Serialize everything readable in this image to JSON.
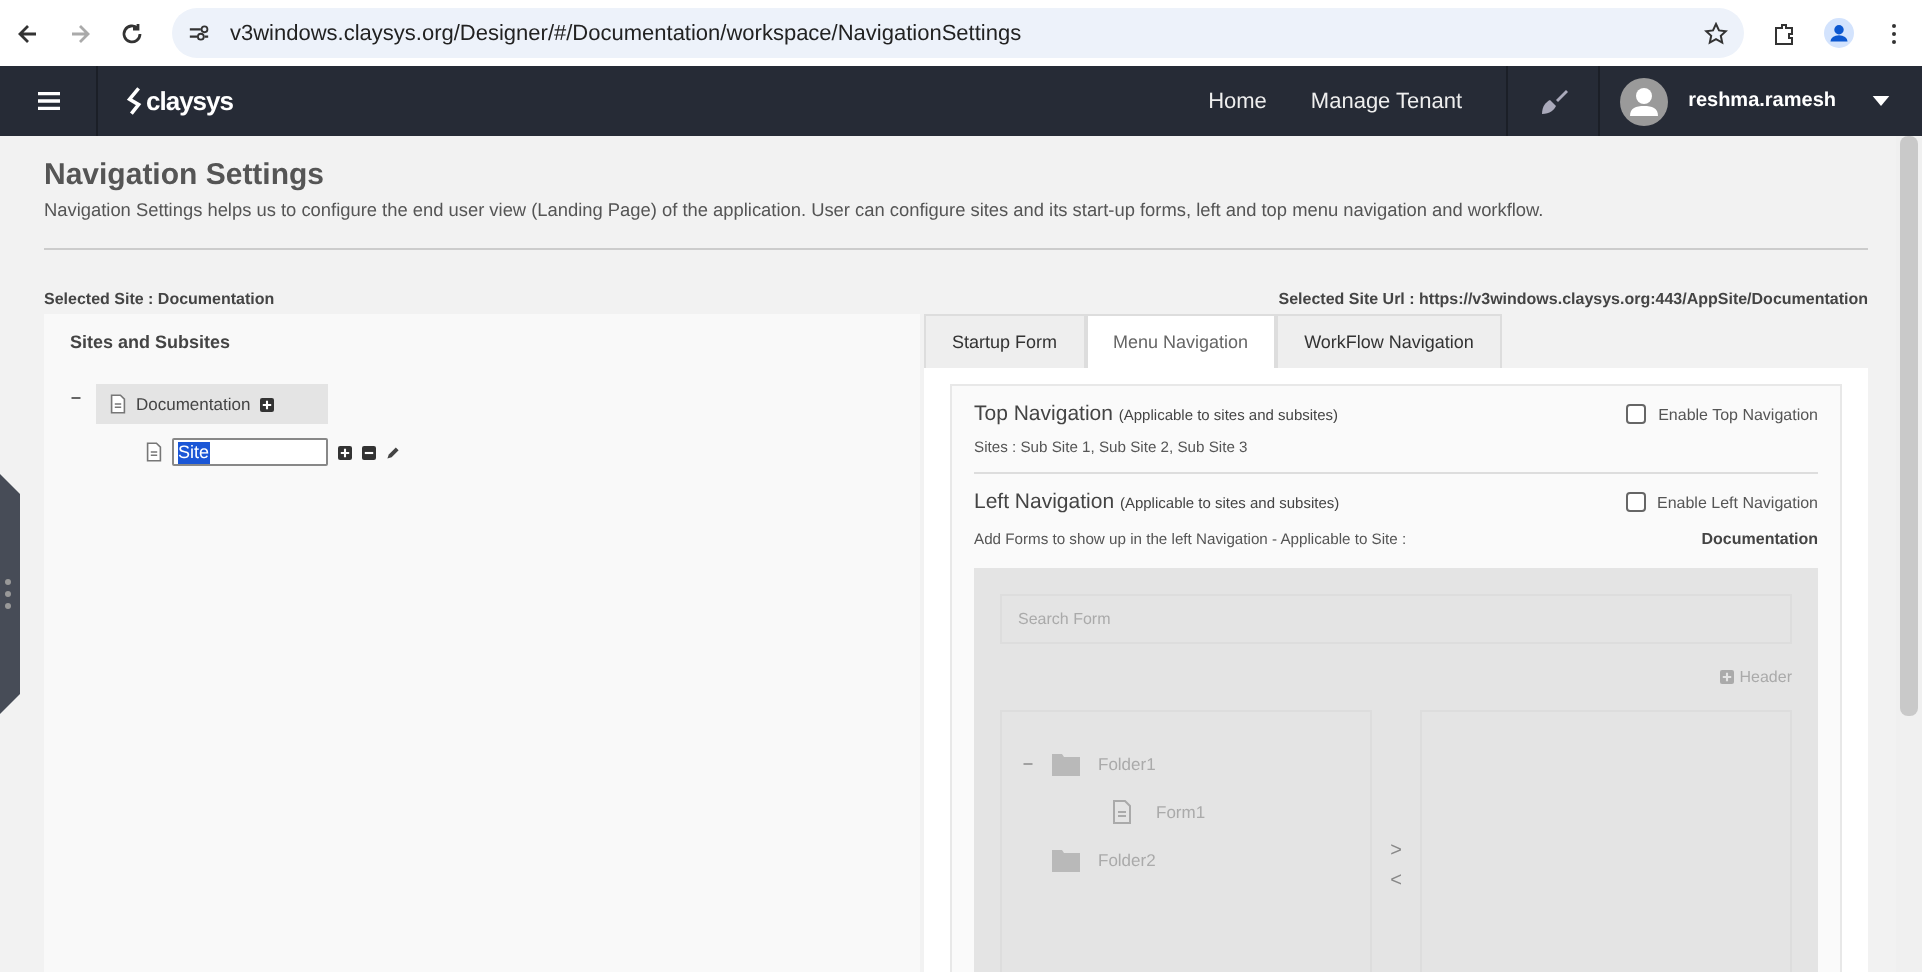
{
  "browser": {
    "url": "v3windows.claysys.org/Designer/#/Documentation/workspace/NavigationSettings"
  },
  "header": {
    "logo": "claysys",
    "links": [
      {
        "label": "Home"
      },
      {
        "label": "Manage Tenant"
      }
    ],
    "user": "reshma.ramesh"
  },
  "page": {
    "title": "Navigation Settings",
    "description": "Navigation Settings helps us to configure the end user view (Landing Page) of the application. User can configure sites and its start-up forms, left and top menu navigation and workflow.",
    "selected_site": "Selected Site : Documentation",
    "selected_site_url": "Selected Site Url : https://v3windows.claysys.org:443/AppSite/Documentation"
  },
  "sites_panel": {
    "title": "Sites and Subsites",
    "tree": [
      {
        "label": "Documentation",
        "expanded": true,
        "selected": true,
        "children": [
          {
            "value": "Site"
          }
        ]
      }
    ]
  },
  "tabs": [
    {
      "label": "Startup Form",
      "selected": false
    },
    {
      "label": "Menu Navigation",
      "selected": true
    },
    {
      "label": "WorkFlow Navigation",
      "selected": false
    }
  ],
  "top_navigation": {
    "title": "Top Navigation",
    "note": "(Applicable to sites and subsites)",
    "checkbox": {
      "label": "Enable Top Navigation",
      "checked": false
    },
    "sites": "Sites : Sub Site 1, Sub Site 2, Sub Site 3"
  },
  "left_navigation": {
    "title": "Left Navigation",
    "note": "(Applicable to sites and subsites)",
    "checkbox": {
      "label": "Enable Left Navigation",
      "checked": false
    },
    "description": "Add Forms to show up in the left Navigation - Applicable to Site :",
    "site": "Documentation"
  },
  "form_picker": {
    "disabled": true,
    "search": {
      "placeholder": "Search Form"
    },
    "header_button": "Header",
    "tree": [
      {
        "kind": "folder",
        "label": "Folder1",
        "expanded": true,
        "children": [
          {
            "kind": "form",
            "label": "Form1"
          }
        ]
      },
      {
        "kind": "folder",
        "label": "Folder2",
        "expanded": false
      }
    ],
    "move_right": ">",
    "move_left": "<"
  }
}
